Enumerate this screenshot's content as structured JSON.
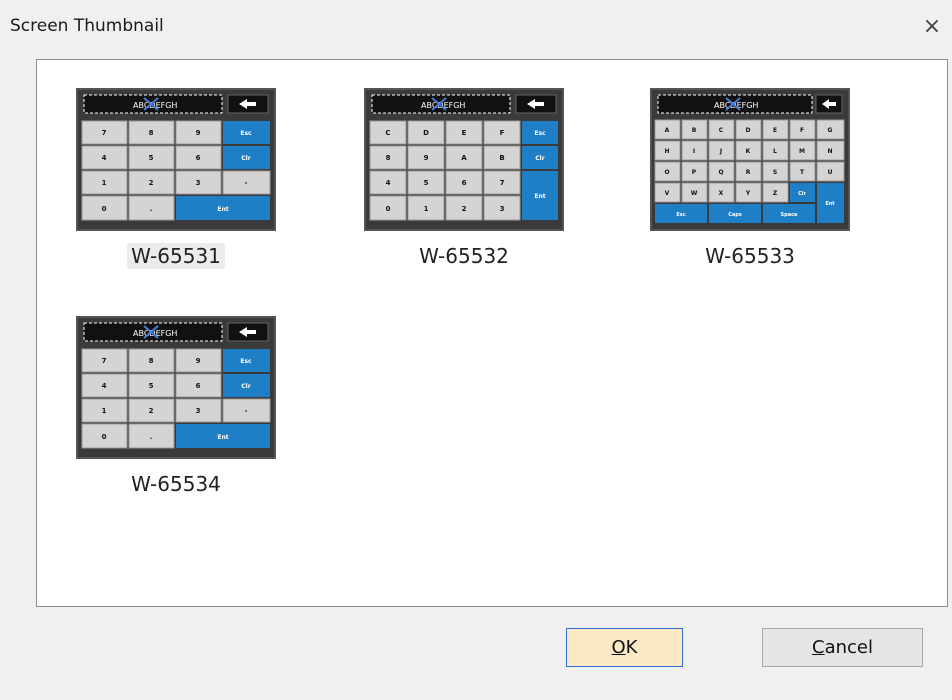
{
  "dialog": {
    "title": "Screen Thumbnail",
    "close_glyph": "×",
    "ok_mnemonic": "O",
    "ok_rest": "K",
    "cancel_mnemonic": "C",
    "cancel_rest": "ancel"
  },
  "thumbnails": [
    {
      "label": "W-65531",
      "selected": true
    },
    {
      "label": "W-65532",
      "selected": false
    },
    {
      "label": "W-65533",
      "selected": false
    },
    {
      "label": "W-65534",
      "selected": false
    }
  ],
  "keypad_preview": {
    "display_text": "ABCDEFGH",
    "numeric_keys": [
      "7",
      "8",
      "9",
      "Esc",
      "4",
      "5",
      "6",
      "Clr",
      "1",
      "2",
      "3",
      "-",
      "0",
      ".",
      "Ent"
    ],
    "hex_keys": [
      "C",
      "D",
      "E",
      "F",
      "Esc",
      "8",
      "9",
      "A",
      "B",
      "Clr",
      "4",
      "5",
      "6",
      "7",
      "Ent",
      "0",
      "1",
      "2",
      "3"
    ],
    "alpha_keys": [
      "A",
      "B",
      "C",
      "D",
      "E",
      "F",
      "G",
      "H",
      "I",
      "J",
      "K",
      "L",
      "M",
      "N",
      "O",
      "P",
      "Q",
      "R",
      "S",
      "T",
      "U",
      "V",
      "W",
      "X",
      "Y",
      "Z",
      "Clr",
      "Ent",
      "Esc",
      "Caps",
      "Space"
    ]
  },
  "colors": {
    "key_blue": "#1f7fc6",
    "key_gray": "#d4d4d4",
    "ok_bg": "#fbe9c5",
    "ok_border": "#2f6fd1"
  }
}
